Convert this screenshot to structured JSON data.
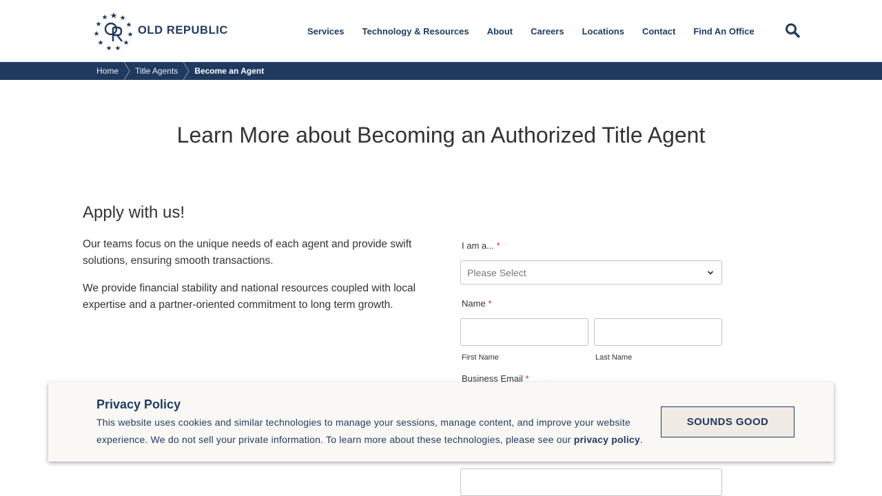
{
  "header": {
    "logo_text": "OLD REPUBLIC",
    "nav": [
      {
        "label": "Services"
      },
      {
        "label": "Technology & Resources"
      },
      {
        "label": "About"
      },
      {
        "label": "Careers"
      },
      {
        "label": "Locations"
      },
      {
        "label": "Contact"
      },
      {
        "label": "Find An Office"
      }
    ],
    "search_icon": "search-icon"
  },
  "breadcrumb": {
    "items": [
      "Home",
      "Title Agents"
    ],
    "current": "Become an Agent"
  },
  "main": {
    "title": "Learn More about Becoming an Authorized Title Agent",
    "apply_heading": "Apply with us!",
    "paragraphs": [
      "Our teams focus on the unique needs of each agent and provide swift solutions, ensuring smooth transactions.",
      "We provide financial stability and national resources coupled with local expertise and a partner-oriented commitment to long term growth."
    ]
  },
  "form": {
    "role_label": "I am a...",
    "role_placeholder": "Please Select",
    "name_label": "Name",
    "first_name_label": "First Name",
    "last_name_label": "Last Name",
    "email_label": "Business Email",
    "required_mark": "*"
  },
  "privacy": {
    "title": "Privacy Policy",
    "text": "This website uses cookies and similar technologies to manage your sessions, manage content, and improve your website experience. We do not sell your private information. To learn more about these technologies, please see our",
    "link": "privacy policy",
    "end": ".",
    "button": "SOUNDS GOOD"
  },
  "colors": {
    "brand_navy": "#1e3a5f",
    "breadcrumb_bg": "#1f3a5f",
    "required": "#e02020",
    "banner_bg": "#faf8f5"
  }
}
